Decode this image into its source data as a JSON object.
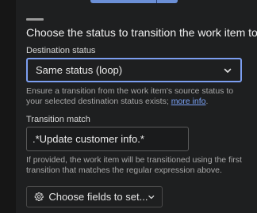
{
  "heading": "Choose the status to transition the work item to:",
  "destination": {
    "label": "Destination status",
    "selected": "Same status (loop)",
    "help_text": "Ensure a transition from the work item's source status to your selected destination status exists; ",
    "help_link": "more info",
    "help_end": "."
  },
  "transition_match": {
    "label": "Transition match",
    "value": ".*Update customer info.*",
    "help_text": "If provided, the work item will be transitioned using the first transition that matches the regular expression above."
  },
  "fields_button": {
    "label": "Choose fields to set...",
    "icon": "gear-icon"
  },
  "colors": {
    "accent": "#7c9ef0",
    "link": "#7aa2f7",
    "background": "#1e1f20"
  }
}
